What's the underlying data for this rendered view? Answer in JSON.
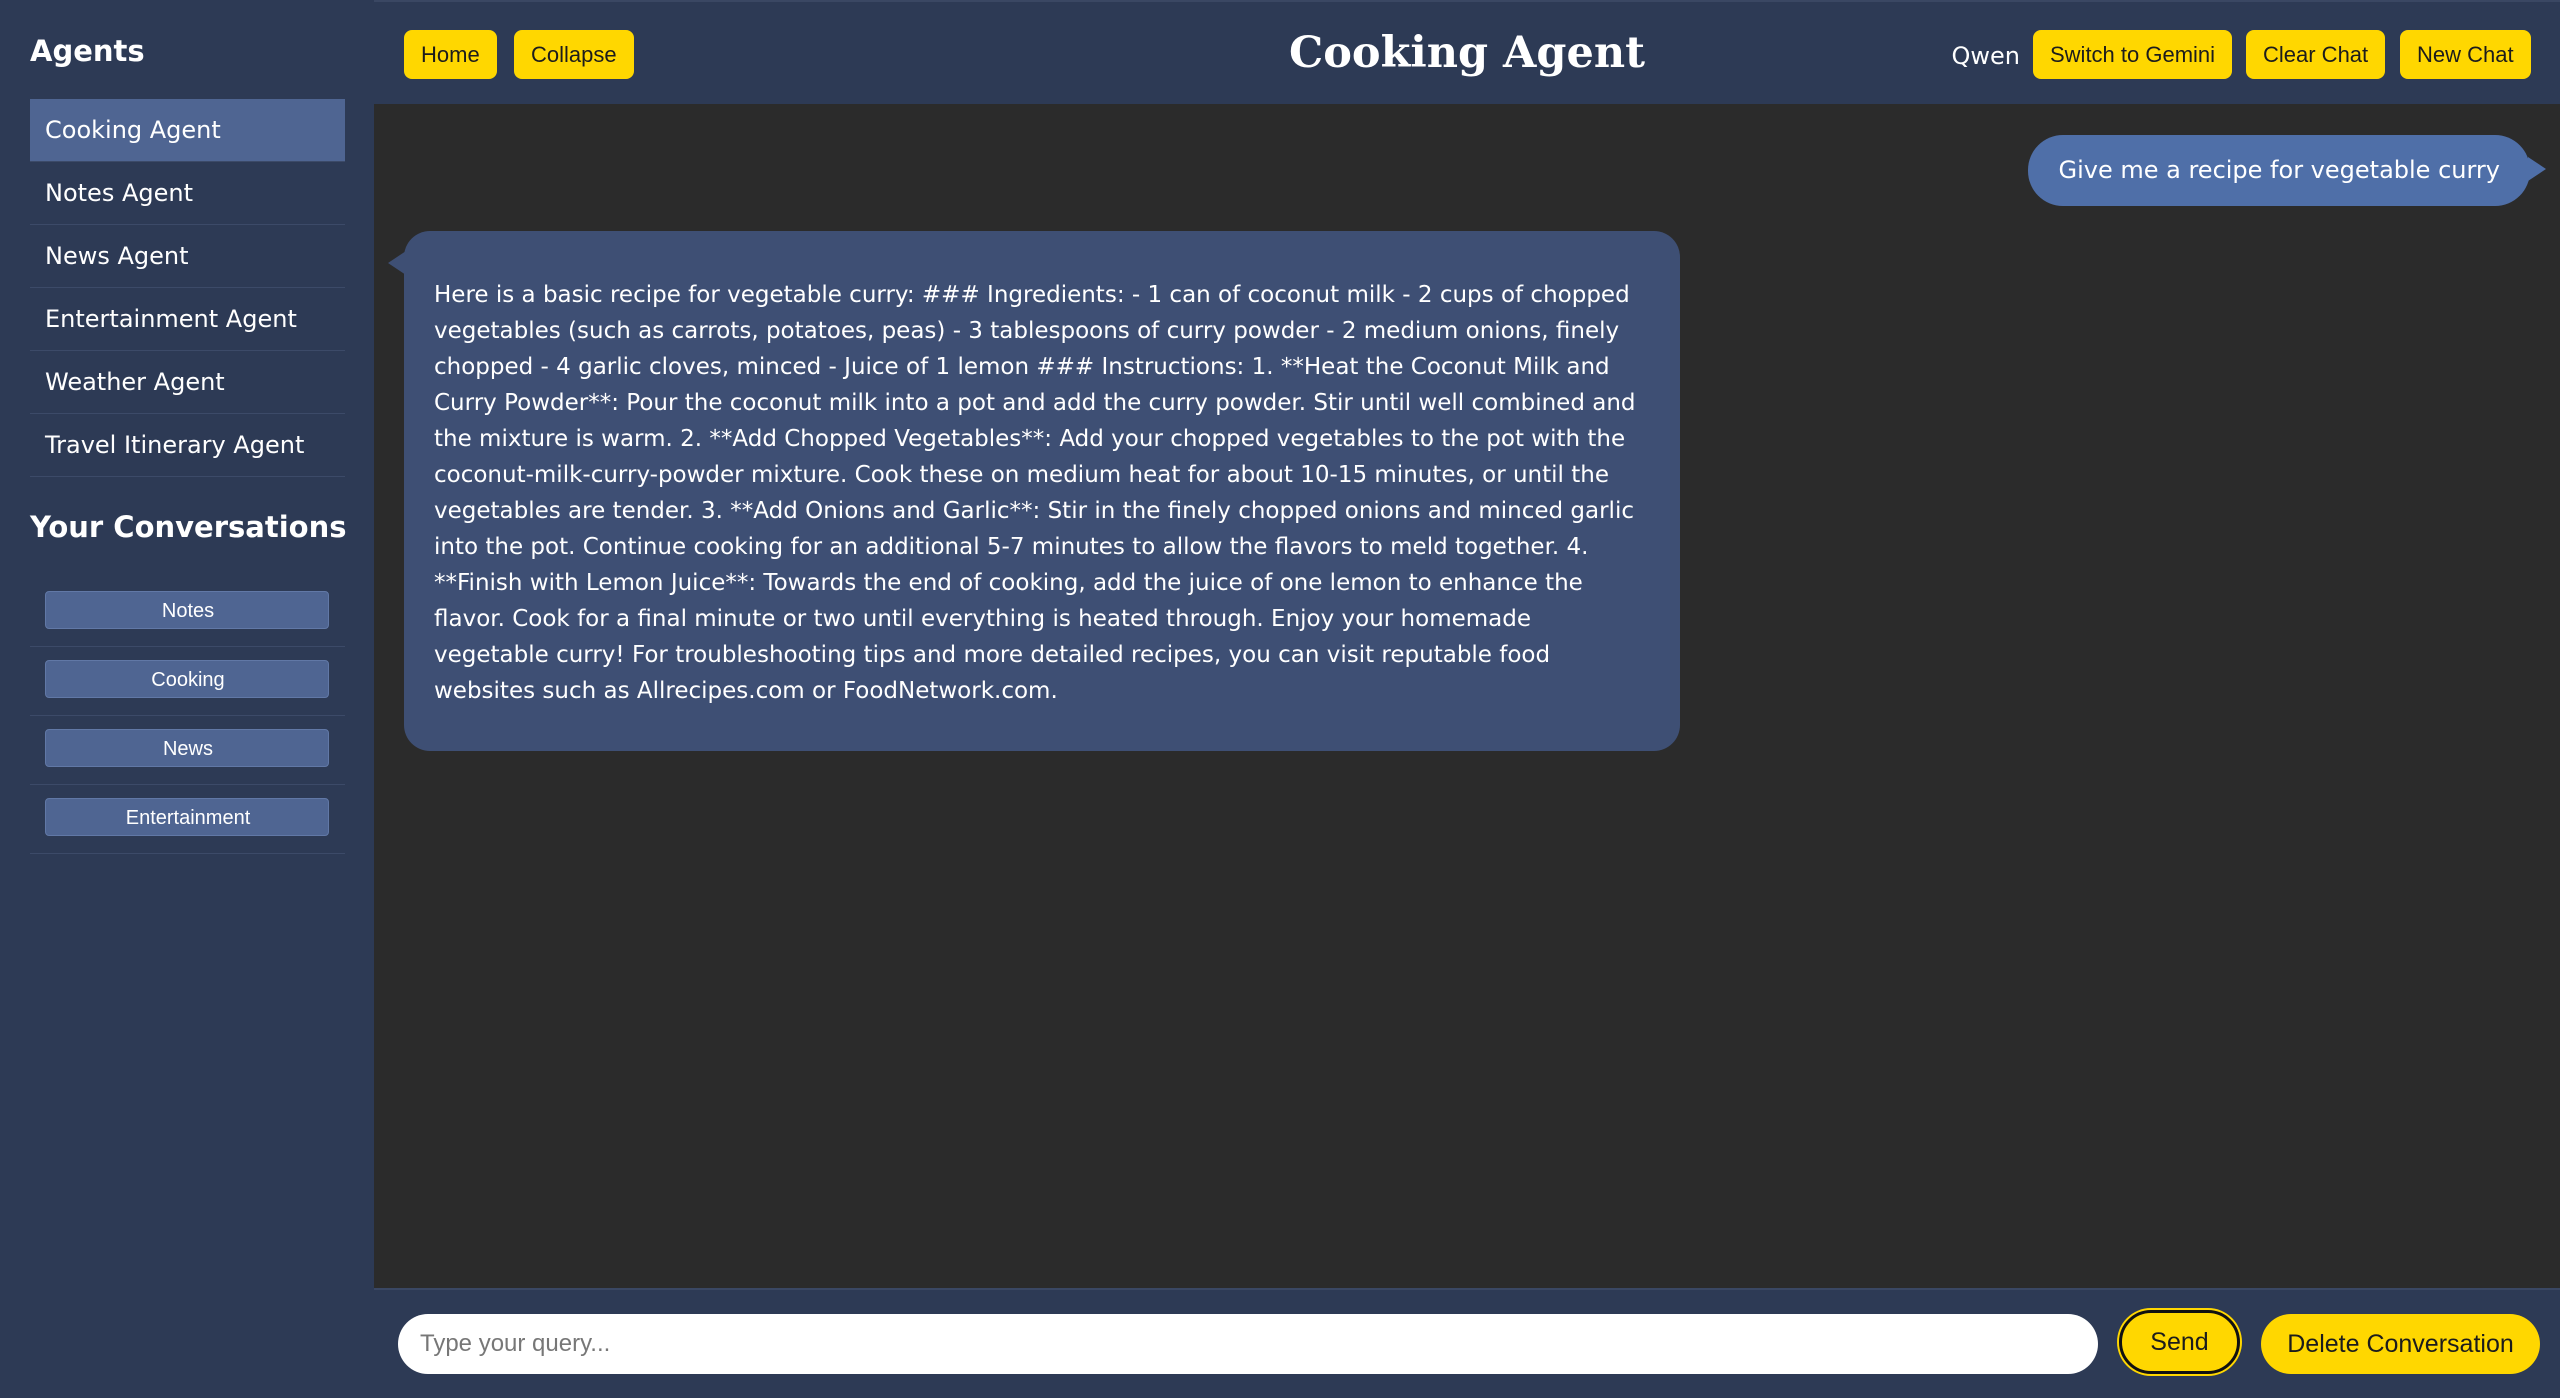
{
  "sidebar": {
    "agents_title": "Agents",
    "agents": [
      {
        "label": "Cooking Agent"
      },
      {
        "label": "Notes Agent"
      },
      {
        "label": "News Agent"
      },
      {
        "label": "Entertainment Agent"
      },
      {
        "label": "Weather Agent"
      },
      {
        "label": "Travel Itinerary Agent"
      }
    ],
    "conversations_title": "Your Conversations",
    "conversations": [
      {
        "label": "Notes"
      },
      {
        "label": "Cooking"
      },
      {
        "label": "News"
      },
      {
        "label": "Entertainment"
      }
    ]
  },
  "header": {
    "home_label": "Home",
    "collapse_label": "Collapse",
    "title": "Cooking Agent",
    "model": "Qwen",
    "switch_label": "Switch to Gemini",
    "clear_label": "Clear Chat",
    "new_label": "New Chat"
  },
  "chat": {
    "user_message": "Give me a recipe for vegetable curry",
    "agent_message": "Here is a basic recipe for vegetable curry: ### Ingredients: - 1 can of coconut milk - 2 cups of chopped vegetables (such as carrots, potatoes, peas) - 3 tablespoons of curry powder - 2 medium onions, finely chopped - 4 garlic cloves, minced - Juice of 1 lemon ### Instructions: 1. **Heat the Coconut Milk and Curry Powder**: Pour the coconut milk into a pot and add the curry powder. Stir until well combined and the mixture is warm. 2. **Add Chopped Vegetables**: Add your chopped vegetables to the pot with the coconut-milk-curry-powder mixture. Cook these on medium heat for about 10-15 minutes, or until the vegetables are tender. 3. **Add Onions and Garlic**: Stir in the finely chopped onions and minced garlic into the pot. Continue cooking for an additional 5-7 minutes to allow the flavors to meld together. 4. **Finish with Lemon Juice**: Towards the end of cooking, add the juice of one lemon to enhance the flavor. Cook for a final minute or two until everything is heated through. Enjoy your homemade vegetable curry! For troubleshooting tips and more detailed recipes, you can visit reputable food websites such as Allrecipes.com or FoodNetwork.com."
  },
  "footer": {
    "placeholder": "Type your query...",
    "send_label": "Send",
    "delete_label": "Delete Conversation"
  },
  "colors": {
    "accent": "#ffd700",
    "sidebar_bg": "#2d3a55",
    "active_item": "#4f6592",
    "user_bubble": "#4f6fa8",
    "agent_bubble": "#3e4f74",
    "chat_bg": "#2b2b2b"
  }
}
